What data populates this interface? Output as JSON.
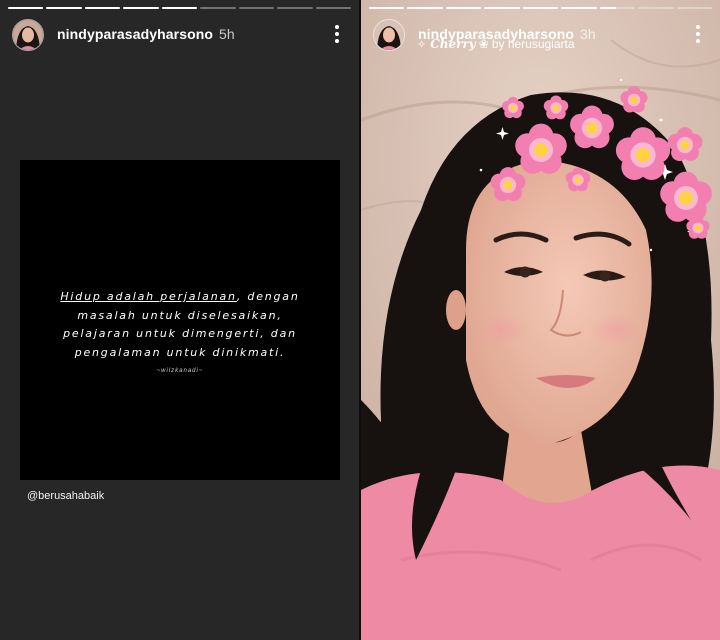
{
  "stories": [
    {
      "username": "nindyparasadyharsono",
      "time": "5h",
      "progress_segments": [
        1,
        1,
        1,
        1,
        1,
        0,
        0,
        0,
        0
      ],
      "quote": {
        "line1_underlined": "Hidup adalah perjalanan",
        "line1_rest": ", dengan",
        "line2": "masalah untuk diselesaikan,",
        "line3": "pelajaran untuk dimengerti, dan",
        "line4": "pengalaman untuk dinikmati.",
        "author": "~wilzkanadi~"
      },
      "mention": "@berusahabaik"
    },
    {
      "username": "nindyparasadyharsono",
      "time": "3h",
      "progress_segments": [
        1,
        1,
        1,
        1,
        1,
        1,
        0.45,
        0,
        0
      ],
      "effect": {
        "sparkle": "✧",
        "name": "Cherry",
        "flower": "❀",
        "by": "by herusugiarta"
      }
    }
  ],
  "colors": {
    "left_bg": "#272727",
    "quote_card": "#000000",
    "flower_petal": "#f27fb0",
    "flower_center": "#ffd23f",
    "shirt": "#ee8aa4"
  },
  "icons": [
    "more-options-icon",
    "sparkle-icon",
    "flower-icon"
  ]
}
